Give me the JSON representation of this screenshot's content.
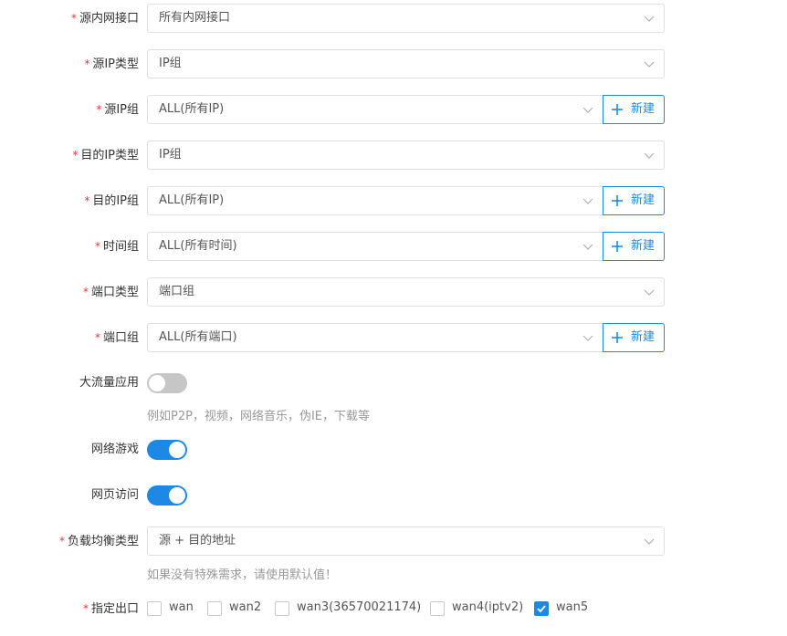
{
  "form": {
    "src_interface": {
      "label": "源内网接口",
      "value": "所有内网接口"
    },
    "src_ip_type": {
      "label": "源IP类型",
      "value": "IP组"
    },
    "src_ip_group": {
      "label": "源IP组",
      "value": "ALL(所有IP)",
      "new_label": "新建"
    },
    "dst_ip_type": {
      "label": "目的IP类型",
      "value": "IP组"
    },
    "dst_ip_group": {
      "label": "目的IP组",
      "value": "ALL(所有IP)",
      "new_label": "新建"
    },
    "time_group": {
      "label": "时间组",
      "value": "ALL(所有时间)",
      "new_label": "新建"
    },
    "port_type": {
      "label": "端口类型",
      "value": "端口组"
    },
    "port_group": {
      "label": "端口组",
      "value": "ALL(所有端口)",
      "new_label": "新建"
    },
    "bulk_app": {
      "label": "大流量应用",
      "enabled": false,
      "hint": "例如P2P，视频，网络音乐，伪IE，下载等"
    },
    "online_game": {
      "label": "网络游戏",
      "enabled": true
    },
    "web_access": {
      "label": "网页访问",
      "enabled": true
    },
    "lb_type": {
      "label": "负载均衡类型",
      "value": "源 + 目的地址",
      "hint": "如果没有特殊需求，请使用默认值！"
    },
    "egress": {
      "label": "指定出口",
      "options": [
        {
          "label": "wan",
          "checked": false
        },
        {
          "label": "wan2",
          "checked": false
        },
        {
          "label": "wan3(36570021174)",
          "checked": false
        },
        {
          "label": "wan4(iptv2)",
          "checked": false
        },
        {
          "label": "wan5",
          "checked": true
        }
      ]
    }
  },
  "required_mark": "*",
  "icons": {
    "dropdown": "chevron-down-icon",
    "add": "plus-icon",
    "check": "check-icon"
  },
  "colors": {
    "accent": "#1e88e5",
    "required": "#e6383a",
    "toggle_off": "#c6c6c6"
  }
}
